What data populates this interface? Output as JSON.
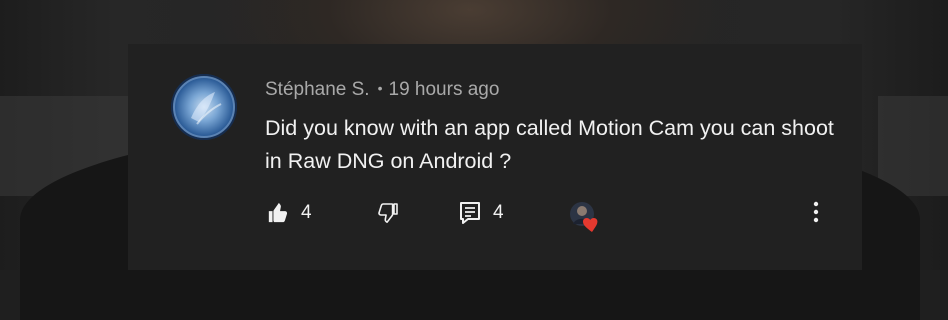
{
  "comment": {
    "author": "Stéphane S.",
    "separator": "•",
    "timestamp": "19 hours ago",
    "text": "Did you know with an app called Motion Cam you can shoot in Raw DNG on Android ?",
    "likes": "4",
    "replies": "4"
  },
  "icons": {
    "like": "thumbs-up-icon",
    "dislike": "thumbs-down-icon",
    "reply": "reply-icon",
    "creator_heart": "creator-heart-icon",
    "more": "more-vertical-icon"
  },
  "colors": {
    "card_background": "#212121",
    "meta_text": "#a9a9a9",
    "body_text": "#f1f1f1",
    "heart": "#e5392f"
  }
}
